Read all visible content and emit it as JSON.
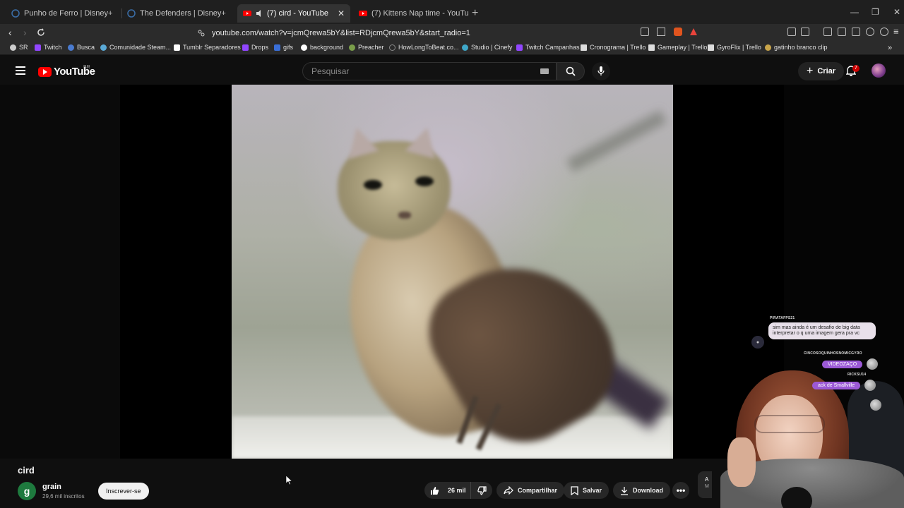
{
  "browser": {
    "tabs": [
      {
        "title": "Punho de Ferro | Disney+",
        "active": false
      },
      {
        "title": "The Defenders | Disney+",
        "active": false
      },
      {
        "title": "(7) cird - YouTube",
        "active": true
      },
      {
        "title": "(7) Kittens Nap time - YouTube",
        "active": false
      }
    ],
    "url": "youtube.com/watch?v=jcmQrewa5bY&list=RDjcmQrewa5bY&start_radio=1",
    "bookmarks": [
      "SR",
      "Twitch",
      "Busca",
      "Comunidade Steam...",
      "Tumblr Separadores",
      "Drops",
      "gifs",
      "background",
      "Preacher",
      "HowLongToBeat.co...",
      "Studio | Cinefy",
      "Twitch Campanhas",
      "Cronograma | Trello",
      "Gameplay | Trello",
      "GyroFlix | Trello",
      "gatinho branco clip"
    ]
  },
  "masthead": {
    "logo": "YouTube",
    "country": "BR",
    "search_placeholder": "Pesquisar",
    "create_label": "Criar",
    "notification_count": "7"
  },
  "video": {
    "title": "cird",
    "channel_initial": "g",
    "channel_name": "grain",
    "subscribers": "29,6 mil inscritos",
    "subscribe_label": "Inscrever-se",
    "likes": "26 mil",
    "share_label": "Compartilhar",
    "save_label": "Salvar",
    "download_label": "Download",
    "side_chip": "A",
    "side_chip_sub": "M"
  },
  "stream_chat": {
    "user1": "PIRATAFPS21",
    "message1": "sim mas ainda é um desafio de big data interpretar o q uma imagem gera pra vc",
    "user2": "CINCOSOQUINHOSNOMICGYRO",
    "message2": "VIDEOZAÇO",
    "user3": "RICKSU14",
    "message3": "ack de Smallville"
  },
  "colors": {
    "youtube_red": "#ff0000",
    "bg": "#0f0f0f",
    "pill_bg": "#272727",
    "chat_pill_purple": "#9b59d6"
  }
}
